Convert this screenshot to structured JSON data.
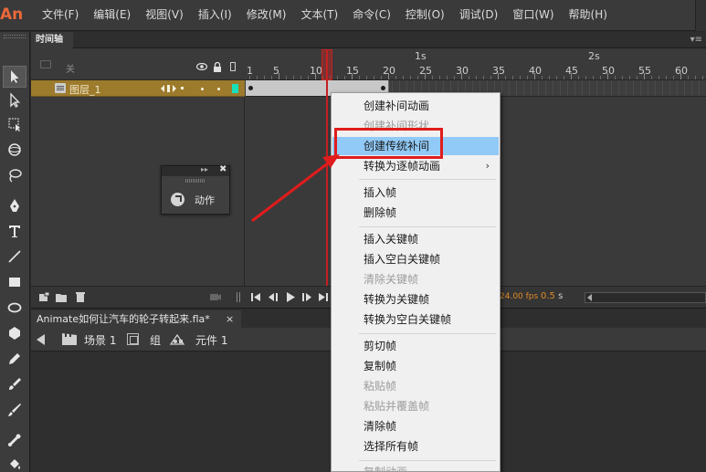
{
  "app": {
    "logo": "An"
  },
  "menu": [
    "文件(F)",
    "编辑(E)",
    "视图(V)",
    "插入(I)",
    "修改(M)",
    "文本(T)",
    "命令(C)",
    "控制(O)",
    "调试(D)",
    "窗口(W)",
    "帮助(H)"
  ],
  "timeline": {
    "tab_label": "时间轴",
    "tab_menu": "▾≡",
    "header_name": "关",
    "layer_name": "图层_1",
    "seconds": [
      "1s",
      "2s"
    ],
    "frame_numbers": [
      "1",
      "5",
      "10",
      "15",
      "20",
      "25",
      "30",
      "35",
      "40",
      "45",
      "50",
      "55",
      "60"
    ],
    "fps": "24.00 fps",
    "time_value": "0.5",
    "time_unit": "s",
    "layer_color": "#19e0bb"
  },
  "document": {
    "tab_title": "Animate如何让汽车的轮子转起来.fla*",
    "close": "×",
    "scene_label": "场景 1",
    "group_label": "组",
    "symbol_label": "元件 1"
  },
  "actions_panel": {
    "collapse": "▸▸",
    "close": "✖",
    "label": "动作"
  },
  "context_menu": {
    "items": [
      {
        "label": "创建补间动画",
        "enabled": true
      },
      {
        "label": "创建补间形状",
        "enabled": false
      },
      {
        "label": "创建传统补间",
        "enabled": true,
        "selected": true
      },
      {
        "label": "转换为逐帧动画",
        "enabled": true,
        "submenu": true
      },
      {
        "label": "插入帧",
        "enabled": true
      },
      {
        "label": "删除帧",
        "enabled": true
      },
      {
        "label": "插入关键帧",
        "enabled": true
      },
      {
        "label": "插入空白关键帧",
        "enabled": true
      },
      {
        "label": "清除关键帧",
        "enabled": false
      },
      {
        "label": "转换为关键帧",
        "enabled": true
      },
      {
        "label": "转换为空白关键帧",
        "enabled": true
      },
      {
        "label": "剪切帧",
        "enabled": true
      },
      {
        "label": "复制帧",
        "enabled": true
      },
      {
        "label": "粘贴帧",
        "enabled": false
      },
      {
        "label": "粘贴并覆盖帧",
        "enabled": false
      },
      {
        "label": "清除帧",
        "enabled": true
      },
      {
        "label": "选择所有帧",
        "enabled": true
      },
      {
        "label": "复制动画",
        "enabled": false
      }
    ],
    "submenu_arrow": "›"
  },
  "colors": {
    "accent_highlight": "#e01c1c",
    "selection": "#91c9f7",
    "layer_row": "#9d7b2c"
  }
}
